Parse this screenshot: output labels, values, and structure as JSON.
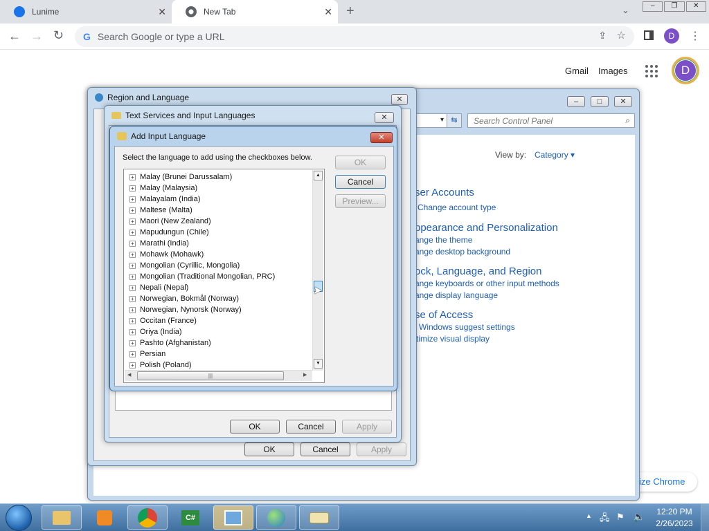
{
  "browser": {
    "tabs": [
      {
        "label": "Lunime",
        "icon": "lunime-icon"
      },
      {
        "label": "New Tab",
        "icon": "chrome-icon"
      }
    ],
    "omnibox_placeholder": "Search Google or type a URL",
    "profile_letter": "D",
    "ntp": {
      "gmail": "Gmail",
      "images": "Images",
      "avatar_letter": "D",
      "customize": "ize Chrome"
    }
  },
  "control_panel": {
    "search_placeholder": "Search Control Panel",
    "view_by_label": "View by:",
    "view_by_value": "Category",
    "sections": [
      {
        "heading": "ser Accounts",
        "links": [
          "Change account type"
        ]
      },
      {
        "heading": "ppearance and Personalization",
        "links": [
          "ange the theme",
          "ange desktop background"
        ]
      },
      {
        "heading": "ock, Language, and Region",
        "links": [
          "ange keyboards or other input methods",
          "ange display language"
        ]
      },
      {
        "heading": "se of Access",
        "links": [
          "Windows suggest settings",
          "timize visual display"
        ]
      }
    ]
  },
  "region_dialog": {
    "title": "Region and Language",
    "ok": "OK",
    "cancel": "Cancel",
    "apply": "Apply"
  },
  "text_services_dialog": {
    "title": "Text Services and Input Languages",
    "ok": "OK",
    "cancel": "Cancel",
    "apply": "Apply"
  },
  "add_input_dialog": {
    "title": "Add Input Language",
    "instruction": "Select the language to add using the checkboxes below.",
    "ok": "OK",
    "cancel": "Cancel",
    "preview": "Preview...",
    "languages": [
      "Malay (Brunei Darussalam)",
      "Malay (Malaysia)",
      "Malayalam (India)",
      "Maltese (Malta)",
      "Maori (New Zealand)",
      "Mapudungun (Chile)",
      "Marathi (India)",
      "Mohawk (Mohawk)",
      "Mongolian (Cyrillic, Mongolia)",
      "Mongolian (Traditional Mongolian, PRC)",
      "Nepali (Nepal)",
      "Norwegian, Bokmål (Norway)",
      "Norwegian, Nynorsk (Norway)",
      "Occitan (France)",
      "Oriya (India)",
      "Pashto (Afghanistan)",
      "Persian",
      "Polish (Poland)"
    ]
  },
  "taskbar": {
    "time": "12:20 PM",
    "date": "2/26/2023"
  },
  "colors": {
    "accent": "#1e5eb5",
    "taskbar": "#4f7fb0",
    "avatar": "#7b4fc7"
  }
}
